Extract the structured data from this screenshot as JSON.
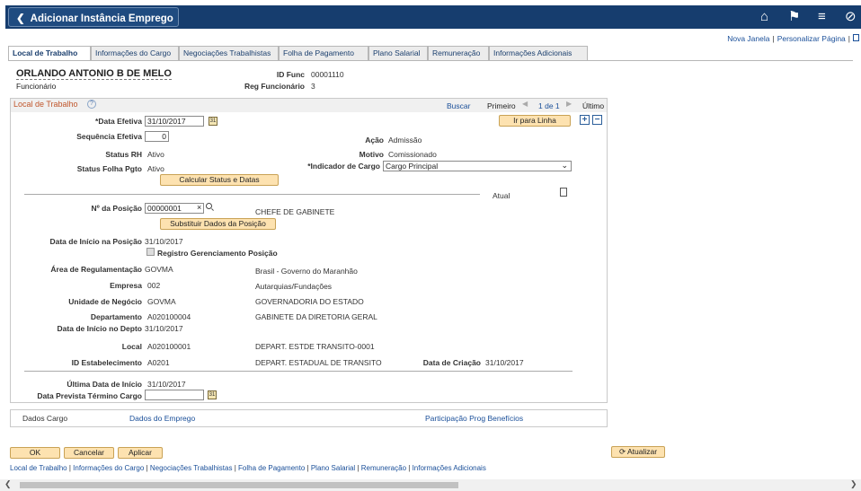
{
  "header": {
    "back_glyph": "❮",
    "title": "Adicionar Instância Emprego",
    "home_glyph": "⌂",
    "flag_glyph": "⚑",
    "menu_glyph": "≡",
    "nav_glyph": "⊘"
  },
  "top_links": {
    "new_window": "Nova Janela",
    "sep": "|",
    "personalize": "Personalizar Página",
    "sep2": "|"
  },
  "tabs": [
    {
      "label": "Local de Trabalho"
    },
    {
      "label": "Informações do Cargo"
    },
    {
      "label": "Negociações Trabalhistas"
    },
    {
      "label": "Folha de Pagamento"
    },
    {
      "label": "Plano Salarial"
    },
    {
      "label": "Remuneração"
    },
    {
      "label": "Informações Adicionais"
    }
  ],
  "employee": {
    "name": "ORLANDO ANTONIO B DE MELO",
    "role": "Funcionário",
    "id_label": "ID Func",
    "id_value": "00001110",
    "reg_label": "Reg Funcionário",
    "reg_value": "3"
  },
  "section": {
    "title": "Local de Trabalho",
    "help_glyph": "?",
    "find": "Buscar",
    "first": "Primeiro",
    "prev_glyph": "◀",
    "count": "1 de 1",
    "next_glyph": "▶",
    "last": "Último",
    "goto_row": "Ir para Linha",
    "add_glyph": "+",
    "del_glyph": "−"
  },
  "form": {
    "effdate_label": "*Data Efetiva",
    "effdate_value": "31/10/2017",
    "cal_glyph": "31",
    "effseq_label": "Sequência Efetiva",
    "effseq_value": "0",
    "action_label": "Ação",
    "action_value": "Admissão",
    "hrstatus_label": "Status RH",
    "hrstatus_value": "Ativo",
    "reason_label": "Motivo",
    "reason_value": "Comissionado",
    "payroll_label": "Status Folha Pgto",
    "payroll_value": "Ativo",
    "jobind_label": "*Indicador de Cargo",
    "jobind_value": "Cargo Principal",
    "calc_button": "Calcular Status e Datas",
    "current": "Atual",
    "position_label": "Nº da Posição",
    "position_value": "00000001",
    "clear_glyph": "×",
    "search_glyph": "🔍",
    "position_desc": "CHEFE DE GABINETE",
    "override_button": "Substituir Dados da Posição",
    "pos_entry_label": "Data de Início na Posição",
    "pos_entry_value": "31/10/2017",
    "pos_mgmt_label": "Registro Gerenciamento Posição",
    "reg_area_label": "Área de Regulamentação",
    "reg_area_value": "GOVMA",
    "reg_area_desc": "Brasil - Governo do Maranhão",
    "company_label": "Empresa",
    "company_value": "002",
    "company_desc": "Autarquias/Fundações",
    "bu_label": "Unidade de Negócio",
    "bu_value": "GOVMA",
    "bu_desc": "GOVERNADORIA DO ESTADO",
    "dept_label": "Departamento",
    "dept_value": "A020100004",
    "dept_desc": "GABINETE DA DIRETORIA GERAL",
    "dept_entry_label": "Data de Início no Depto",
    "dept_entry_value": "31/10/2017",
    "location_label": "Local",
    "location_value": "A020100001",
    "location_desc": "DEPART. ESTDE TRANSITO-0001",
    "estab_label": "ID Estabelecimento",
    "estab_value": "A0201",
    "estab_desc": "DEPART. ESTADUAL DE TRANSITO",
    "created_label": "Data de Criação",
    "created_value": "31/10/2017",
    "last_start_label": "Última Data de Início",
    "last_start_value": "31/10/2017",
    "expected_end_label": "Data Prevista Término Cargo",
    "expected_end_value": ""
  },
  "related": {
    "job_data": "Dados Cargo",
    "employment_data": "Dados do Emprego",
    "benefits": "Participação Prog Benefícios"
  },
  "actions": {
    "ok": "OK",
    "cancel": "Cancelar",
    "apply": "Aplicar",
    "refresh_glyph": "⟳",
    "refresh": "Atualizar"
  },
  "bottom_links": [
    "Local de Trabalho",
    "Informações do Cargo",
    "Negociações Trabalhistas",
    "Folha de Pagamento",
    "Plano Salarial",
    "Remuneração",
    "Informações Adicionais"
  ],
  "bottom_sep": "|",
  "scroll": {
    "left_glyph": "❮",
    "right_glyph": "❯"
  }
}
